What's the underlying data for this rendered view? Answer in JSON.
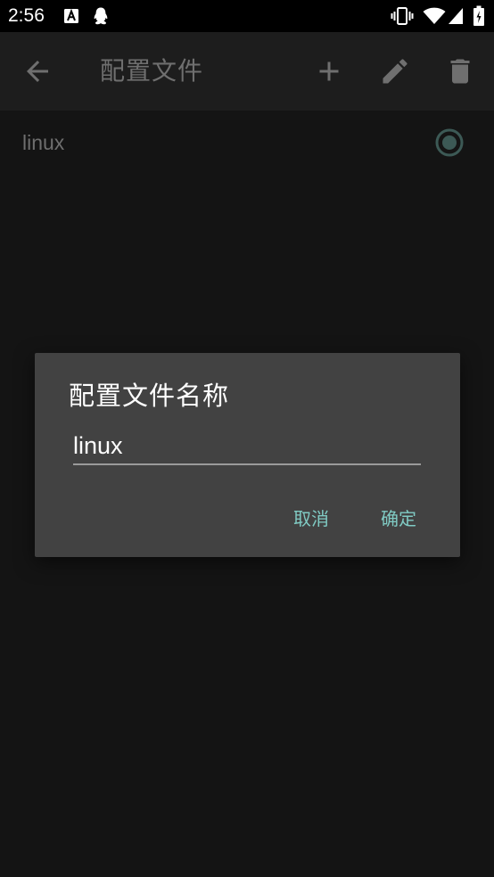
{
  "status_bar": {
    "time": "2:56",
    "left_icons": [
      "a-notification-icon",
      "qq-penguin-icon"
    ],
    "right_icons": [
      "vibrate-icon",
      "wifi-icon",
      "signal-icon",
      "battery-icon"
    ]
  },
  "app_bar": {
    "title": "配置文件",
    "back_icon": "arrow-back-icon",
    "actions": [
      "add-icon",
      "edit-icon",
      "delete-icon"
    ]
  },
  "profiles": [
    {
      "name": "linux",
      "selected": true
    }
  ],
  "dialog": {
    "title": "配置文件名称",
    "input_value": "linux",
    "cancel_label": "取消",
    "confirm_label": "确定"
  },
  "colors": {
    "accent": "#80cbc4",
    "dialog_background": "#424242",
    "app_background": "#141414",
    "app_bar_background": "#1d1d1d"
  }
}
